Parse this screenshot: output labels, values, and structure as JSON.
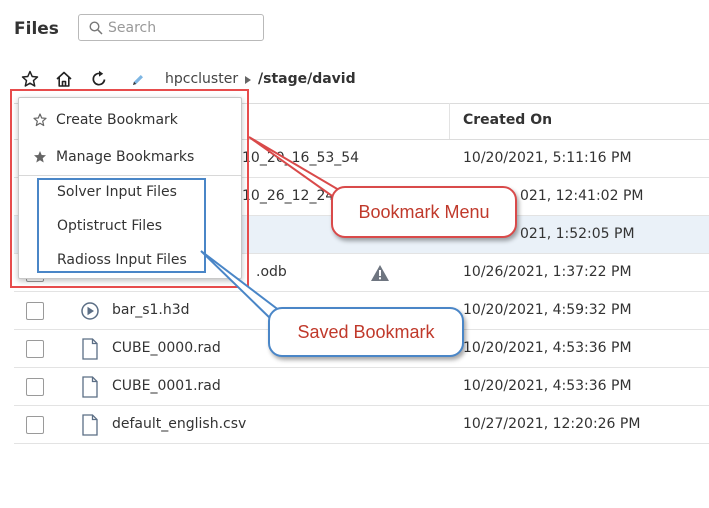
{
  "header": {
    "title": "Files",
    "search_placeholder": "Search"
  },
  "breadcrumb": {
    "server": "hpccluster",
    "path": "/stage/david"
  },
  "table": {
    "created_header": "Created On",
    "rows": [
      {
        "name": "10_20_16_53_54",
        "created": "10/20/2021, 5:11:16 PM",
        "icon": "file-icon"
      },
      {
        "name": "10_26_12_24_",
        "created": "021, 12:41:02 PM",
        "icon": "file-icon"
      },
      {
        "name": "",
        "created": "021, 1:52:05 PM",
        "icon": "file-icon"
      },
      {
        "name": ".odb",
        "created": "10/26/2021, 1:37:22 PM",
        "icon": "file-icon",
        "warning": true
      },
      {
        "name": "bar_s1.h3d",
        "created": "10/20/2021, 4:59:32 PM",
        "icon": "play-icon"
      },
      {
        "name": "CUBE_0000.rad",
        "created": "10/20/2021, 4:53:36 PM",
        "icon": "file-icon"
      },
      {
        "name": "CUBE_0001.rad",
        "created": "10/20/2021, 4:53:36 PM",
        "icon": "file-icon"
      },
      {
        "name": "default_english.csv",
        "created": "10/27/2021, 12:20:26 PM",
        "icon": "file-icon"
      }
    ]
  },
  "bookmark_menu": {
    "create": "Create Bookmark",
    "manage": "Manage Bookmarks",
    "bookmarks": [
      "Solver Input Files",
      "Optistruct Files",
      "Radioss Input Files"
    ]
  },
  "annotations": {
    "menu_callout": "Bookmark Menu",
    "saved_callout": "Saved Bookmark",
    "red": "#e74c4c",
    "blue": "#4a86c7"
  }
}
